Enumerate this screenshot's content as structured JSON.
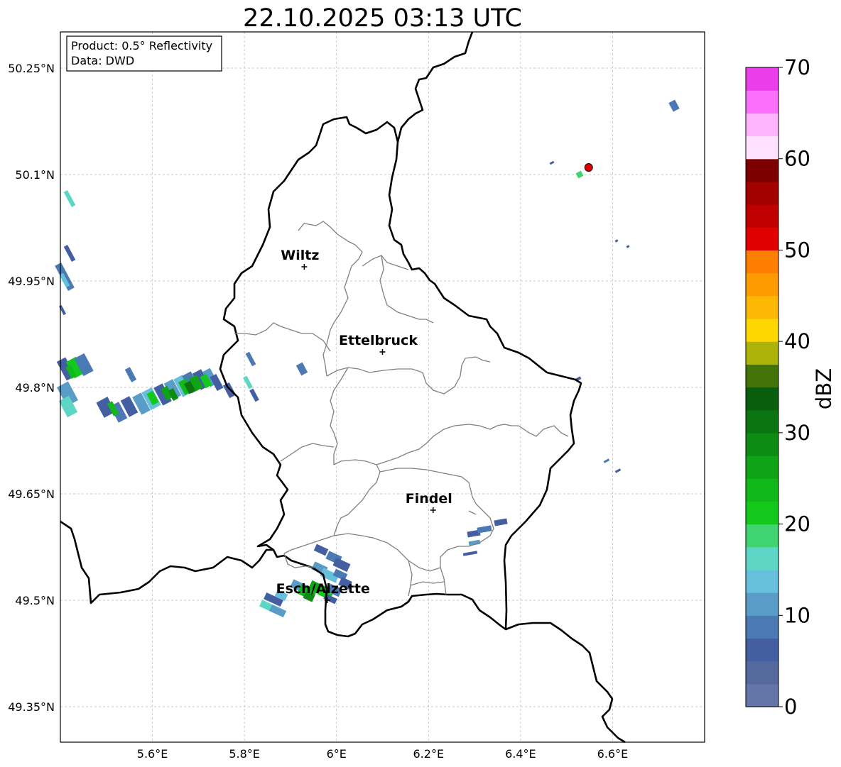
{
  "title": "22.10.2025 03:13 UTC",
  "info_box": {
    "product": "Product: 0.5° Reflectivity",
    "data": "Data: DWD"
  },
  "map": {
    "lon_range": [
      5.4,
      6.8
    ],
    "lat_range": [
      49.3,
      50.3
    ],
    "lat_ticks": [
      {
        "value": 50.25,
        "label": "50.25°N"
      },
      {
        "value": 50.1,
        "label": "50.1°N"
      },
      {
        "value": 49.95,
        "label": "49.95°N"
      },
      {
        "value": 49.8,
        "label": "49.8°N"
      },
      {
        "value": 49.65,
        "label": "49.65°N"
      },
      {
        "value": 49.5,
        "label": "49.5°N"
      },
      {
        "value": 49.35,
        "label": "49.35°N"
      }
    ],
    "lon_ticks": [
      {
        "value": 5.6,
        "label": "5.6°E"
      },
      {
        "value": 5.8,
        "label": "5.8°E"
      },
      {
        "value": 6.0,
        "label": "6°E"
      },
      {
        "value": 6.2,
        "label": "6.2°E"
      },
      {
        "value": 6.4,
        "label": "6.4°E"
      },
      {
        "value": 6.6,
        "label": "6.6°E"
      }
    ],
    "cities": [
      {
        "name": "Wiltz",
        "lon": 5.93,
        "lat": 49.97
      },
      {
        "name": "Ettelbruck",
        "lon": 6.1,
        "lat": 49.85
      },
      {
        "name": "Findel",
        "lon": 6.21,
        "lat": 49.627
      },
      {
        "name": "Esch/Alzette",
        "lon": 5.98,
        "lat": 49.5
      }
    ],
    "radar_site": {
      "lon": 6.548,
      "lat": 50.11,
      "color": "#e00000"
    }
  },
  "colorbar": {
    "label": "dBZ",
    "min": 0,
    "max": 70,
    "step": 2.5,
    "ticks": [
      {
        "value": 0,
        "label": "0"
      },
      {
        "value": 10,
        "label": "10"
      },
      {
        "value": 20,
        "label": "20"
      },
      {
        "value": 30,
        "label": "30"
      },
      {
        "value": 40,
        "label": "40"
      },
      {
        "value": 50,
        "label": "50"
      },
      {
        "value": 60,
        "label": "60"
      },
      {
        "value": 70,
        "label": "70"
      }
    ],
    "colors": [
      "#6475a8",
      "#55699f",
      "#445fa1",
      "#4a79b4",
      "#5a9cc8",
      "#66bfdb",
      "#5ed6c6",
      "#3fd46f",
      "#12c81b",
      "#10b81a",
      "#0fa415",
      "#0d8b12",
      "#0b7511",
      "#085e0d",
      "#447408",
      "#aeb309",
      "#fed700",
      "#fdb805",
      "#fe9b00",
      "#fe7f00",
      "#e10000",
      "#c00000",
      "#a30000",
      "#7c0000",
      "#fee2fe",
      "#fdb4fd",
      "#fc6ffc",
      "#eb3de9"
    ]
  }
}
